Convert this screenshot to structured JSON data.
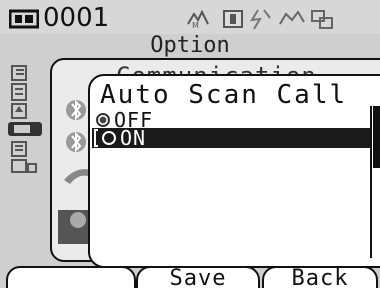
{
  "status": {
    "id": "0001"
  },
  "title": "Option",
  "comm_panel": {
    "title": "Communication"
  },
  "dialog": {
    "title": "Auto Scan Call",
    "options": [
      {
        "label": "OFF",
        "selected": true,
        "focused": false
      },
      {
        "label": "ON",
        "selected": false,
        "focused": true
      }
    ]
  },
  "softkeys": {
    "left": "",
    "save": "Save",
    "back": "Back"
  },
  "colors": {
    "background": "#cfcfcf",
    "dialog": "#ffffff",
    "highlight": "#1a1a1a"
  }
}
